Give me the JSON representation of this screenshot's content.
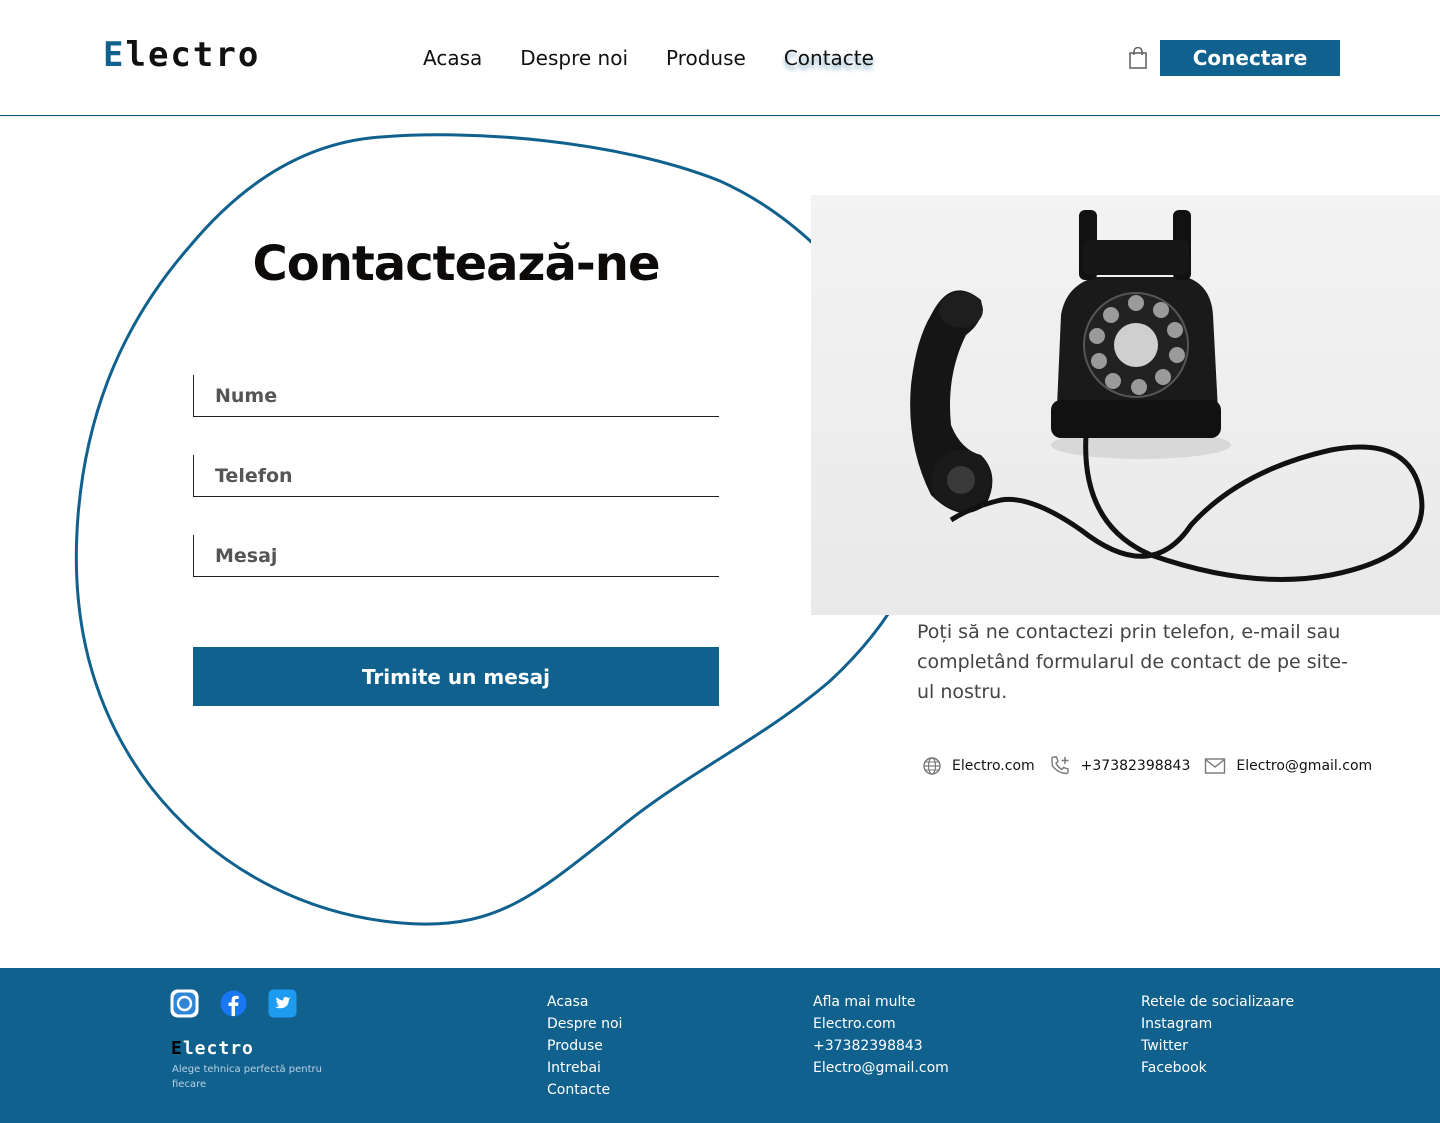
{
  "header": {
    "logo_first": "E",
    "logo_rest": "lectro",
    "nav": [
      "Acasa",
      "Despre noi",
      "Produse",
      "Contacte"
    ],
    "active_nav": "Contacte",
    "connect_label": "Conectare",
    "bag_icon": "shopping-bag-icon"
  },
  "colors": {
    "accent": "#11618f",
    "text": "#111111",
    "muted": "#444444"
  },
  "contact": {
    "title": "Contactează-ne",
    "fields": {
      "name_placeholder": "Nume",
      "phone_placeholder": "Telefon",
      "message_placeholder": "Mesaj"
    },
    "submit_label": "Trimite un mesaj",
    "photo_alt": "telephone-photo",
    "description": "Poți să ne contactezi prin telefon, e-mail sau completând formularul de contact de pe site-ul nostru.",
    "info": {
      "website": "Electro.com",
      "phone": "+37382398843",
      "email": "Electro@gmail.com"
    }
  },
  "footer": {
    "social_icons": [
      "instagram-icon",
      "facebook-icon",
      "twitter-icon"
    ],
    "logo_first": "E",
    "logo_rest": "lectro",
    "tagline": "Alege tehnica perfectă pentru fiecare",
    "col1": [
      "Acasa",
      "Despre noi",
      "Produse",
      "Intrebai",
      "Contacte"
    ],
    "col2": [
      "Afla mai multe",
      "Electro.com",
      "+37382398843",
      "Electro@gmail.com"
    ],
    "col3": [
      "Retele de socializaare",
      "Instagram",
      "Twitter",
      "Facebook"
    ]
  }
}
